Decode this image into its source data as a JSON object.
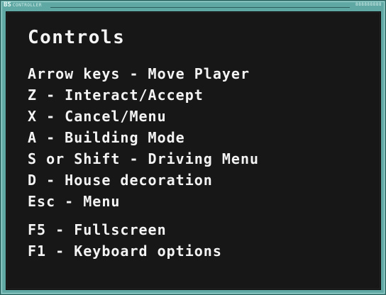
{
  "window": {
    "title_main": "BS",
    "title_small": "CONTROLLER",
    "id_label": "888888888"
  },
  "content": {
    "heading": "Controls",
    "primary_controls": [
      "Arrow keys - Move Player",
      "Z - Interact/Accept",
      "X - Cancel/Menu",
      "A - Building Mode",
      "S or Shift - Driving Menu",
      "D - House decoration",
      "Esc - Menu"
    ],
    "system_controls": [
      "F5 - Fullscreen",
      "F1 - Keyboard options"
    ]
  }
}
